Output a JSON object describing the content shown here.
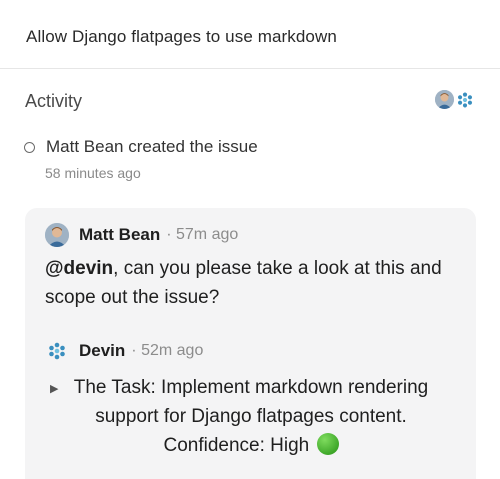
{
  "issue": {
    "title": "Allow Django flatpages to use markdown"
  },
  "activity": {
    "heading": "Activity",
    "created_event": {
      "text": "Matt Bean created the issue",
      "time": "58 minutes ago"
    }
  },
  "comment": {
    "author": "Matt Bean",
    "time": "· 57m ago",
    "mention": "@devin",
    "body_rest": ", can you please take a look at this and scope out the issue?",
    "reply": {
      "author": "Devin",
      "time": "· 52m ago",
      "body": "The Task: Implement markdown rendering support for Django flatpages content. Confidence: High"
    }
  },
  "icons": {
    "status_circle": "green-circle-icon",
    "expand": "triangle-right-icon"
  },
  "colors": {
    "devin_brand": "#3a8fbf",
    "confidence_high": "#3fa82a"
  }
}
